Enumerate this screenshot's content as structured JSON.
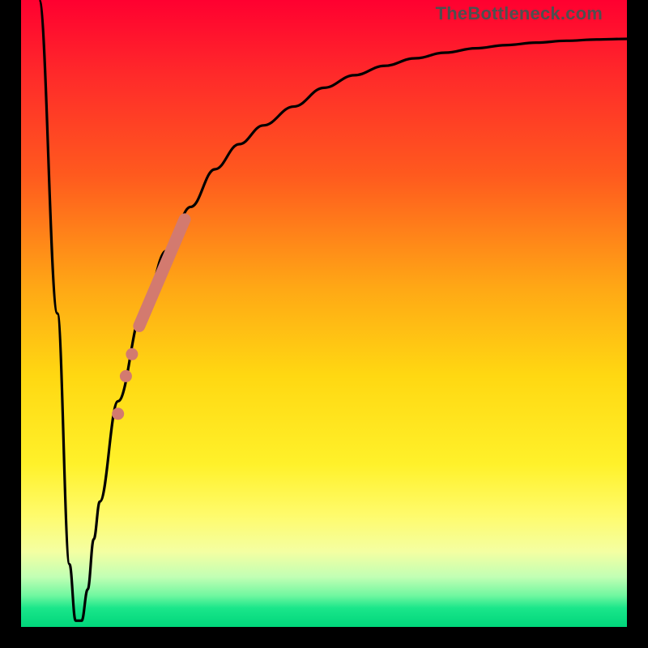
{
  "attribution": "TheBottleneck.com",
  "colors": {
    "curve": "#000000",
    "marker": "#d37a6f",
    "frame": "#000000"
  },
  "chart_data": {
    "type": "line",
    "title": "",
    "xlabel": "",
    "ylabel": "",
    "xlim": [
      0,
      100
    ],
    "ylim": [
      0,
      100
    ],
    "grid": false,
    "legend": false,
    "series": [
      {
        "name": "bottleneck-curve",
        "x": [
          3,
          6,
          8,
          9,
          10,
          11,
          12,
          13,
          16,
          20,
          24,
          28,
          32,
          36,
          40,
          45,
          50,
          55,
          60,
          65,
          70,
          75,
          80,
          85,
          90,
          95,
          100
        ],
        "y": [
          100,
          50,
          10,
          1,
          1,
          6,
          14,
          20,
          36,
          50,
          60,
          67,
          73,
          77,
          80,
          83,
          86,
          88,
          89.5,
          90.7,
          91.6,
          92.3,
          92.8,
          93.2,
          93.5,
          93.7,
          93.8
        ]
      }
    ],
    "markers": [
      {
        "name": "thick-segment",
        "type": "segment",
        "x": [
          19.5,
          27
        ],
        "y": [
          48,
          65
        ]
      },
      {
        "name": "dot-1",
        "type": "dot",
        "x": 18.3,
        "y": 43.5
      },
      {
        "name": "dot-2",
        "type": "dot",
        "x": 17.3,
        "y": 40
      },
      {
        "name": "dot-3",
        "type": "dot",
        "x": 16.0,
        "y": 34
      }
    ]
  }
}
